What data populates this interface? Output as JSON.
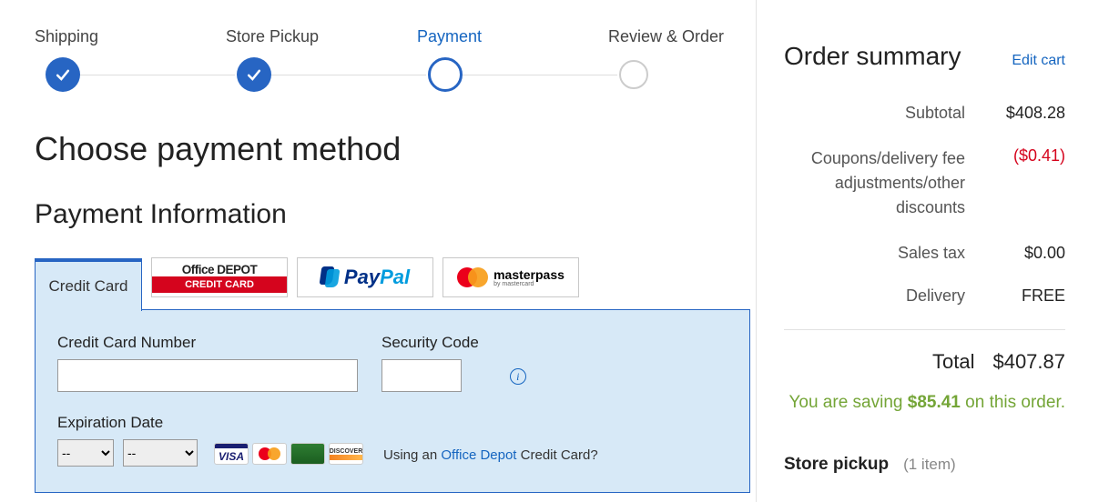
{
  "stepper": {
    "steps": [
      {
        "label": "Shipping"
      },
      {
        "label": "Store Pickup"
      },
      {
        "label": "Payment"
      },
      {
        "label": "Review & Order"
      }
    ]
  },
  "headings": {
    "choose": "Choose payment method",
    "payment_info": "Payment Information"
  },
  "tabs": {
    "cc": "Credit Card",
    "od_top": "Office DEPOT",
    "od_bot": "CREDIT CARD",
    "paypal_a": "Pay",
    "paypal_b": "Pal",
    "masterpass": "masterpass",
    "masterpass_sub": "by mastercard"
  },
  "form": {
    "cc_label": "Credit Card Number",
    "sec_label": "Security Code",
    "exp_label": "Expiration Date",
    "month_placeholder": "--",
    "year_placeholder": "--",
    "using_pre": "Using an ",
    "using_link": "Office Depot",
    "using_post": " Credit Card?",
    "visa": "VISA",
    "discover": "DISCOVER"
  },
  "summary": {
    "title": "Order summary",
    "edit": "Edit cart",
    "lines": {
      "subtotal_lbl": "Subtotal",
      "subtotal_val": "$408.28",
      "coupon_lbl": "Coupons/delivery fee adjustments/other discounts",
      "coupon_val": "($0.41)",
      "tax_lbl": "Sales tax",
      "tax_val": "$0.00",
      "delivery_lbl": "Delivery",
      "delivery_val": "FREE"
    },
    "total_lbl": "Total",
    "total_val": "$407.87",
    "saving_pre": "You are saving ",
    "saving_amt": "$85.41",
    "saving_post": " on this order."
  },
  "pickup": {
    "title": "Store pickup",
    "count": "(1 item)"
  }
}
